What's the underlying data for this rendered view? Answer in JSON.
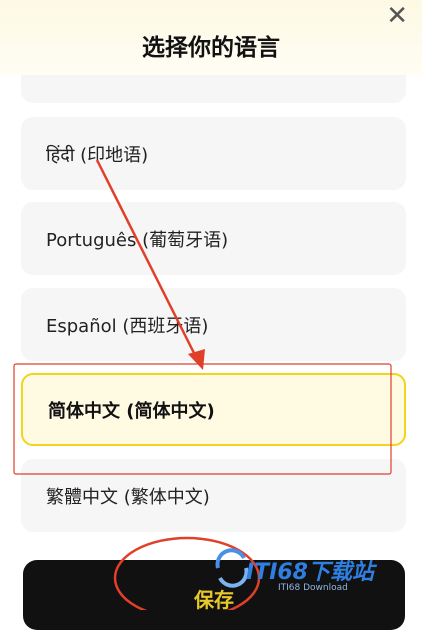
{
  "header": {
    "title": "选择你的语言",
    "close_glyph": "✕"
  },
  "languages": [
    {
      "label": "(...)"
    },
    {
      "label": "हिंदी (印地语)"
    },
    {
      "label": "Português (葡萄牙语)"
    },
    {
      "label": "Español (西班牙语)"
    },
    {
      "label": "简体中文 (简体中文)",
      "selected": true
    },
    {
      "label": "繁體中文 (繁体中文)"
    }
  ],
  "footer": {
    "save_label": "保存"
  },
  "watermark": {
    "brand": "ITI68下载站",
    "sub": "ITI68 Download"
  },
  "colors": {
    "accent": "#f2d41e",
    "button": "#111111",
    "annotation": "#e0402a"
  }
}
